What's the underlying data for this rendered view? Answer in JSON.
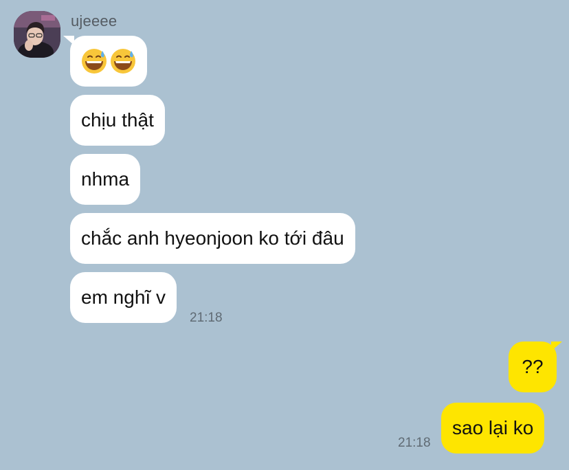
{
  "chat": {
    "sender_name": "ujeeee",
    "incoming": [
      {
        "text": "",
        "emoji": [
          "grinning-sweat-emoji",
          "grinning-sweat-emoji"
        ]
      },
      {
        "text": "chịu thật"
      },
      {
        "text": "nhma"
      },
      {
        "text": "chắc anh hyeonjoon ko tới đâu"
      },
      {
        "text": "em nghĩ v"
      }
    ],
    "incoming_time": "21:18",
    "outgoing": [
      {
        "text": "??"
      },
      {
        "text": "sao lại ko"
      }
    ],
    "outgoing_time": "21:18"
  },
  "colors": {
    "background": "#abc1d1",
    "incoming_bubble": "#ffffff",
    "outgoing_bubble": "#fee500",
    "timestamp": "#5f6a73"
  }
}
